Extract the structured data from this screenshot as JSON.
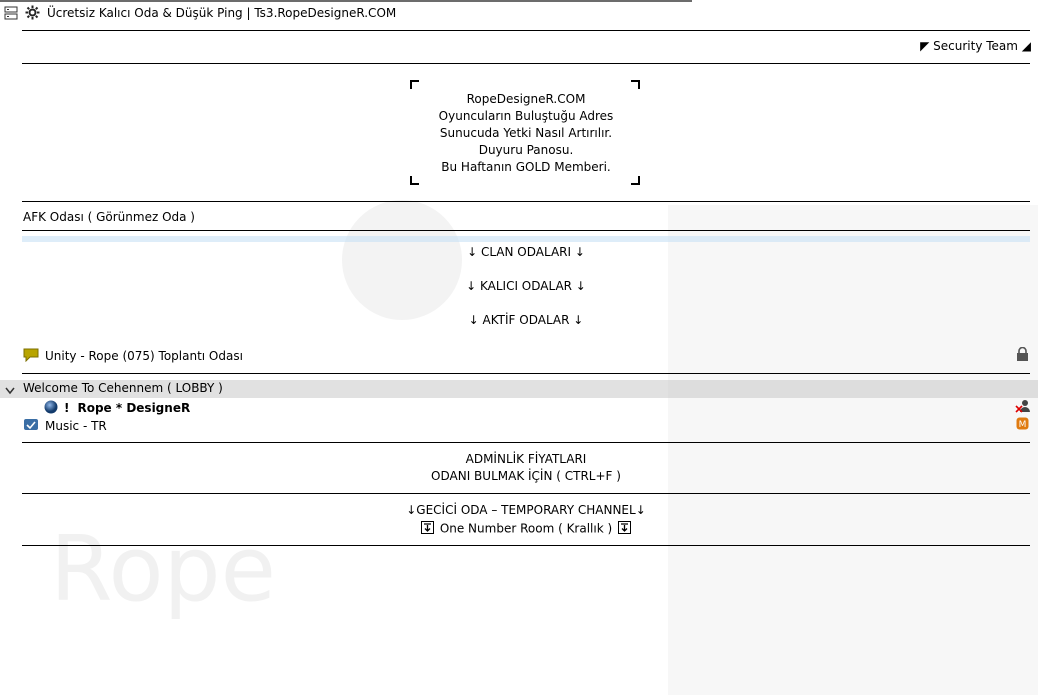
{
  "titlebar": {
    "title": "Ücretsiz Kalıcı Oda & Düşük Ping | Ts3.RopeDesigneR.COM"
  },
  "spacer_right": {
    "label": "◤ Security Team ◢"
  },
  "banner": {
    "lines": [
      "RopeDesigneR.COM",
      "Oyuncuların Buluştuğu Adres",
      "Sunucuda Yetki Nasıl Artırılır.",
      "Duyuru Panosu.",
      "Bu Haftanın GOLD Memberi."
    ]
  },
  "channels": {
    "afk": "AFK Odası ( Görünmez Oda )",
    "clan": "↓ CLAN ODALARI ↓",
    "kalici": "↓ KALICI ODALAR ↓",
    "aktif": "↓ AKTİF ODALAR ↓",
    "unity": "Unity - Rope (075) Toplantı Odası",
    "lobby": "Welcome To Cehennem ( LOBBY )",
    "user_prefix": "!",
    "user_name": "Rope * DesigneR",
    "music": "Music - TR",
    "adminlik": "ADMİNLİK FİYATLARI",
    "odani_bul": "ODANI BULMAK İÇİN ( CTRL+F )",
    "gecici": "↓GECİCİ ODA – TEMPORARY CHANNEL↓",
    "one_number": "One Number Room ( Krallık )"
  },
  "colors": {
    "separator": "#000000",
    "lobby_highlight": "#c8c8c8",
    "unity_icon": "#b8a400",
    "music_icon": "#3a6ea5",
    "badge": "#e07b10"
  },
  "icons": {
    "server": "server-icon",
    "app": "gear-icon",
    "unity": "chat-bubble-icon",
    "lobby_toggle": "chevron-down-icon",
    "user_status": "status-orb-icon",
    "music": "channel-icon",
    "lock": "lock-icon",
    "mute": "muted-user-icon",
    "badge": "badge-icon",
    "room_marker": "arrow-box-icon"
  }
}
